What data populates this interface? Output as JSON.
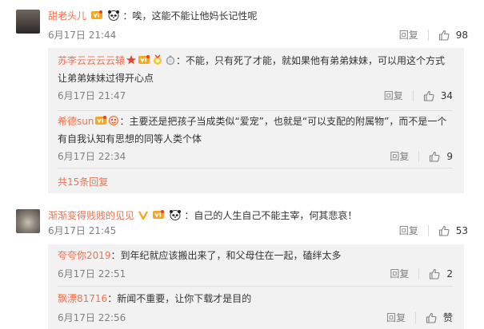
{
  "comments": [
    {
      "author": "甜老头儿",
      "content": "：唉，这能不能让他妈长记性呢",
      "date": "6月17日 21:44",
      "reply_label": "回复",
      "likes": "98",
      "replies": [
        {
          "author": "苏李云云云云辕",
          "content": "：不能，只有死了才能，就如果他有弟弟妹妹，可以用这个方式让弟弟妹妹过得开心点",
          "date": "6月17日 21:47",
          "reply_label": "回复",
          "likes": "34"
        },
        {
          "author": "希德sun",
          "content": "：主要还是把孩子当成类似“爱宠”，也就是“可以支配的附属物”，而不是一个有自我认知有思想的同等人类个体",
          "date": "6月17日 22:34",
          "reply_label": "回复",
          "likes": "9"
        }
      ],
      "more_replies": "共15条回复"
    },
    {
      "author": "渐渐变得贱贱的见见",
      "content": "：自己的人生自己不能主宰，何其悲哀！",
      "date": "6月17日 21:45",
      "reply_label": "回复",
      "likes": "53",
      "replies": [
        {
          "author": "夸夸你2019",
          "content": "：到年纪就应该搬出来了，和父母住在一起，磕绊太多",
          "date": "6月17日 22:51",
          "reply_label": "回复",
          "likes": "2"
        },
        {
          "author": "飘漂81716",
          "content": "：新闻不重要，让你下载才是目的",
          "date": "6月17日 22:56",
          "reply_label": "回复",
          "likes": "赞"
        }
      ]
    }
  ],
  "colors": {
    "author": "#eb7350",
    "sub_bg": "#f2f2f2",
    "meta": "#808080"
  }
}
